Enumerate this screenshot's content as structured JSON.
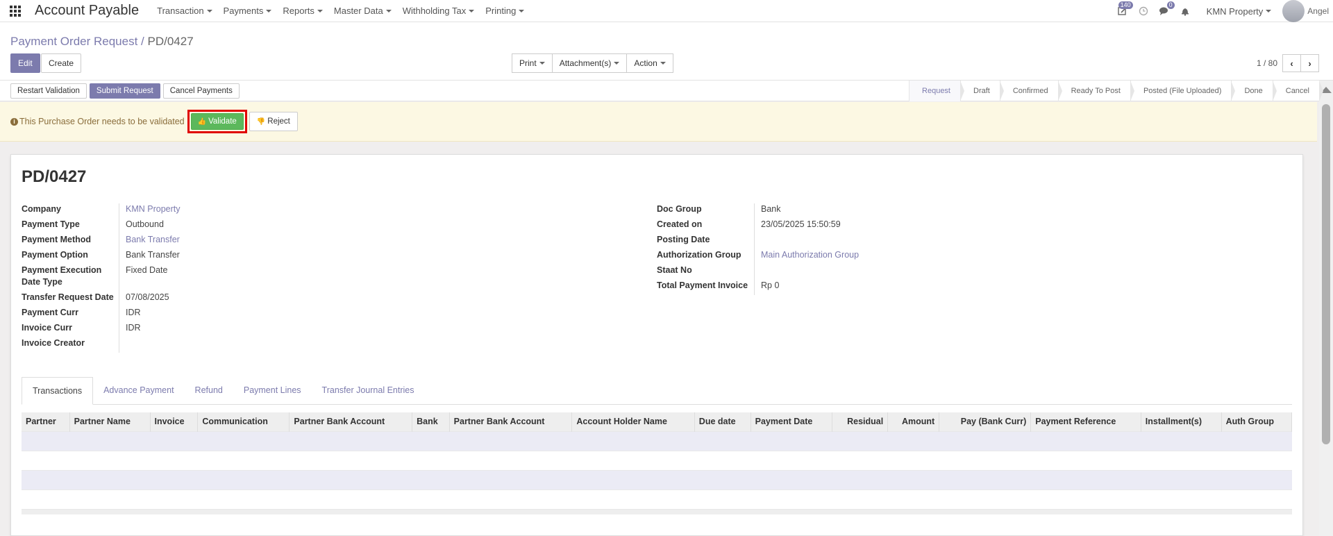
{
  "navbar": {
    "app_title": "Account Payable",
    "menu": [
      "Transaction",
      "Payments",
      "Reports",
      "Master Data",
      "Withholding Tax",
      "Printing"
    ],
    "activity_count": "140",
    "message_count": "0",
    "company": "KMN Property",
    "user": "Angel"
  },
  "breadcrumb": {
    "parent": "Payment Order Request",
    "separator": "/",
    "current": "PD/0427"
  },
  "actions": {
    "edit": "Edit",
    "create": "Create",
    "print": "Print",
    "attachments": "Attachment(s)",
    "action": "Action"
  },
  "pager": {
    "value": "1 / 80"
  },
  "status_buttons": {
    "restart": "Restart Validation",
    "submit": "Submit Request",
    "cancel": "Cancel Payments"
  },
  "stages": [
    "Request",
    "Draft",
    "Confirmed",
    "Ready To Post",
    "Posted (File Uploaded)",
    "Done",
    "Cancel"
  ],
  "alert": {
    "text": "This Purchase Order needs to be validated",
    "validate": "Validate",
    "reject": "Reject"
  },
  "record": {
    "title": "PD/0427",
    "left_fields": [
      {
        "label": "Company",
        "value": "KMN Property",
        "link": true
      },
      {
        "label": "Payment Type",
        "value": "Outbound",
        "link": false
      },
      {
        "label": "Payment Method",
        "value": "Bank Transfer",
        "link": true
      },
      {
        "label": "Payment Option",
        "value": "Bank Transfer",
        "link": false
      },
      {
        "label": "Payment Execution Date Type",
        "value": "Fixed Date",
        "link": false
      },
      {
        "label": "Transfer Request Date",
        "value": "07/08/2025",
        "link": false
      },
      {
        "label": "Payment Curr",
        "value": "IDR",
        "link": false
      },
      {
        "label": "Invoice Curr",
        "value": "IDR",
        "link": false
      },
      {
        "label": "Invoice Creator",
        "value": "",
        "link": false
      }
    ],
    "right_fields": [
      {
        "label": "Doc Group",
        "value": "Bank",
        "link": false
      },
      {
        "label": "Created on",
        "value": "23/05/2025 15:50:59",
        "link": false
      },
      {
        "label": "Posting Date",
        "value": "",
        "link": false
      },
      {
        "label": "Authorization Group",
        "value": "Main Authorization Group",
        "link": true
      },
      {
        "label": "Staat No",
        "value": "",
        "link": false
      },
      {
        "label": "Total Payment Invoice",
        "value": "Rp 0",
        "link": false
      }
    ]
  },
  "tabs": [
    "Transactions",
    "Advance Payment",
    "Refund",
    "Payment Lines",
    "Transfer Journal Entries"
  ],
  "table": {
    "columns": [
      "Partner",
      "Partner Name",
      "Invoice",
      "Communication",
      "Partner Bank Account",
      "Bank",
      "Partner Bank Account",
      "Account Holder Name",
      "Due date",
      "Payment Date",
      "Residual",
      "Amount",
      "Pay (Bank Curr)",
      "Payment Reference",
      "Installment(s)",
      "Auth Group"
    ]
  }
}
